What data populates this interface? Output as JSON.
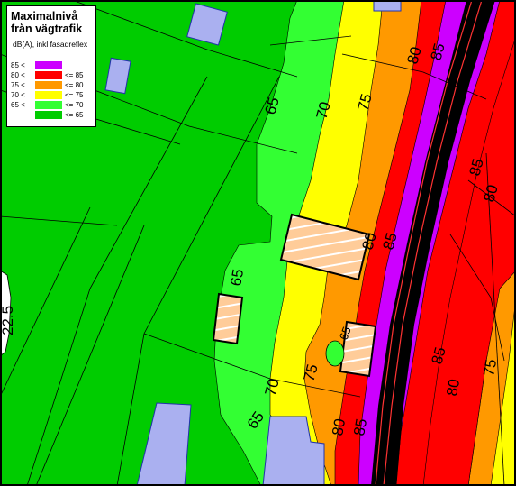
{
  "legend": {
    "title": "Maximalnivå från vägtrafik",
    "subtitle": "dB(A), inkl fasadreflex",
    "rows": [
      {
        "low": "85 <",
        "high": "",
        "color": "#cc00ff"
      },
      {
        "low": "80 <",
        "high": "<= 85",
        "color": "#ff0000"
      },
      {
        "low": "75 <",
        "high": "<= 80",
        "color": "#ff9900"
      },
      {
        "low": "70 <",
        "high": "<= 75",
        "color": "#ffff00"
      },
      {
        "low": "65 <",
        "high": "<= 70",
        "color": "#33ff33"
      },
      {
        "low": "",
        "high": "<= 65",
        "color": "#00cc00"
      }
    ]
  },
  "contour_labels": {
    "c65_top": "65",
    "c70_top": "70",
    "c75_top": "75",
    "c80_top": "80",
    "c85_top": "85",
    "c85_right": "85",
    "c80_right": "80",
    "c65_mid": "65",
    "c80_mid": "80",
    "c85_mid": "85",
    "c65_house": "65",
    "c75_low": "75",
    "c70_low": "70",
    "c65_low": "65",
    "c80_low": "80",
    "c85_low": "85",
    "c85_east": "85",
    "c80_east": "80",
    "c75_east": "75"
  },
  "edge_label": "22.5",
  "colors": {
    "lvl_le65": "#00cc00",
    "lvl_65_70": "#33ff33",
    "lvl_70_75": "#ffff00",
    "lvl_75_80": "#ff9900",
    "lvl_80_85": "#ff0000",
    "lvl_gt85": "#cc00ff",
    "road": "#000000",
    "building_existing": "#aab0f0",
    "building_planned": "#ffcc99"
  }
}
